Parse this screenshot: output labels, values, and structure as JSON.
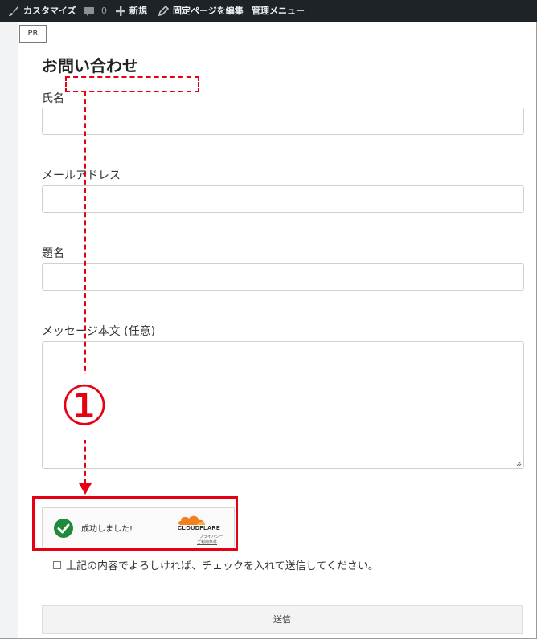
{
  "admin_bar": {
    "customize_label": "カスタマイズ",
    "comment_count": "0",
    "new_label": "新規",
    "edit_label": "固定ページを編集",
    "admin_menu_label": "管理メニュー"
  },
  "pr_badge": "PR",
  "form": {
    "title": "お問い合わせ",
    "fields": [
      {
        "label": "氏名"
      },
      {
        "label": "メールアドレス"
      },
      {
        "label": "題名"
      },
      {
        "label": "メッセージ本文 (任意)"
      }
    ],
    "turnstile": {
      "status": "成功しました!",
      "brand": "CLOUDFLARE",
      "privacy_link": "プライバシー",
      "terms_link": "ご利用条件"
    },
    "agree_label": "上記の内容でよろしければ、チェックを入れて送信してください。",
    "submit_label": "送信"
  },
  "annotation": {
    "step": "①",
    "color": "#e60012"
  }
}
